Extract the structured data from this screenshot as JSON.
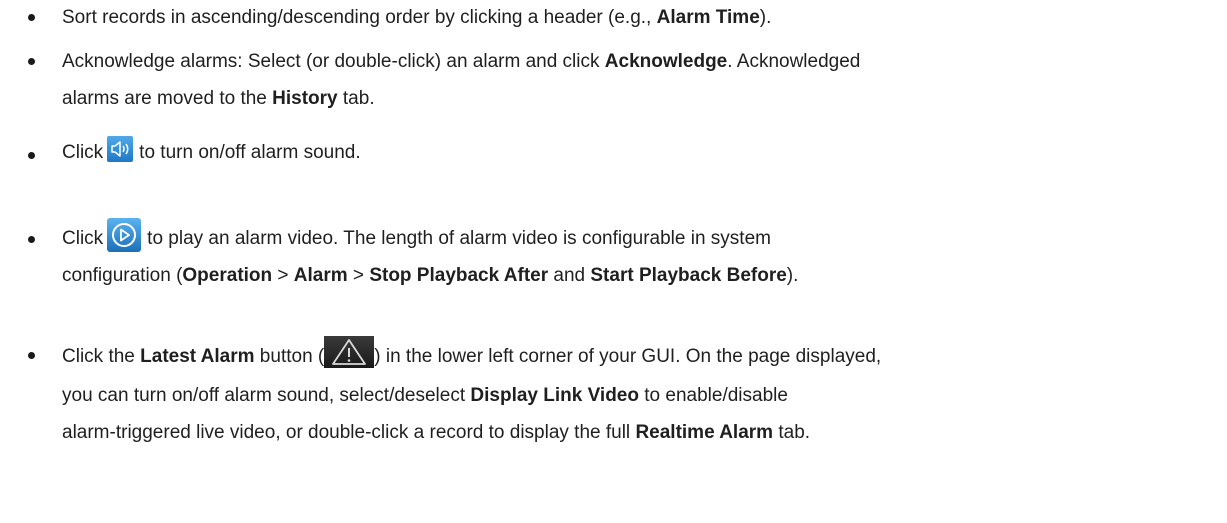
{
  "bullets": [
    {
      "pre": "Sort records in ascending/descending order by clicking a header (e.g., ",
      "bold1": "Alarm Time",
      "post": ")."
    },
    {
      "pre": "Acknowledge alarms: Select (or double-click) an alarm and click ",
      "bold1": "Acknowledge",
      "mid": ". Acknowledged",
      "line2_pre": "alarms are moved to the ",
      "bold2": "History",
      "line2_post": " tab."
    },
    {
      "pre": "Click",
      "icon": "speaker-icon",
      "post": "to turn on/off alarm sound."
    },
    {
      "pre": "Click",
      "icon": "play-icon",
      "post": "to play an alarm video. The length of alarm video is configurable in system",
      "line2_pre": "configuration (",
      "bold1": "Operation",
      "sep1": " > ",
      "bold2": "Alarm",
      "sep2": " > ",
      "bold3": "Stop Playback After",
      "and": " and ",
      "bold4": "Start Playback Before",
      "line2_post": ")."
    },
    {
      "pre": "Click the ",
      "bold1": "Latest Alarm",
      "mid1": " button (",
      "icon": "alarm-warning-icon",
      "mid2": ") in the lower left corner of your GUI. On the page displayed,",
      "line2_pre": "you can turn on/off alarm sound, select/deselect ",
      "bold2": "Display Link Video",
      "line2_post": " to enable/disable",
      "line3_pre": "alarm-triggered live video, or double-click a record to display the full ",
      "bold3": "Realtime Alarm",
      "line3_post": " tab."
    }
  ],
  "colors": {
    "icon_blue": "#2f8fd6",
    "icon_blue_dark": "#1565a8",
    "text": "#1f1f1f"
  }
}
